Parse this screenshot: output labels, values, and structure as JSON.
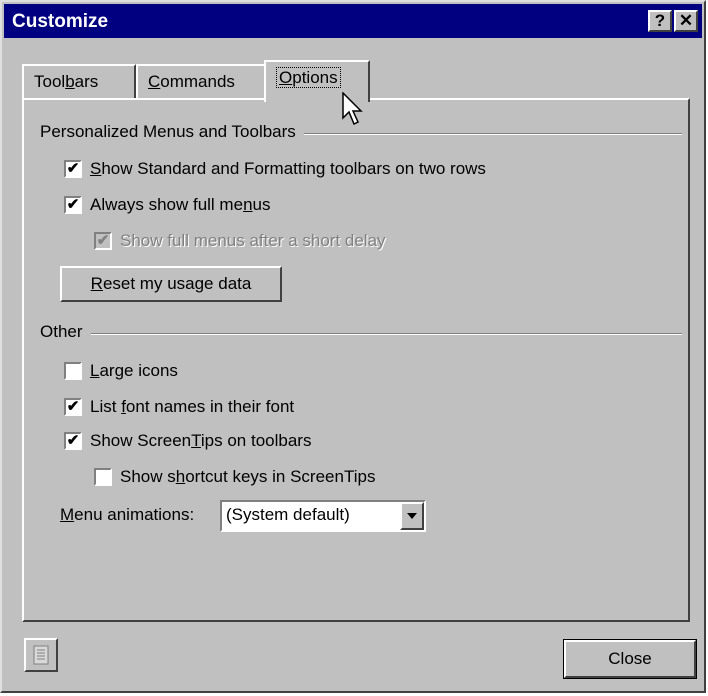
{
  "window": {
    "title": "Customize",
    "help_label": "?",
    "close_label": "✕"
  },
  "tabs": [
    {
      "pre": "Tool",
      "u": "b",
      "post": "ars"
    },
    {
      "pre": "",
      "u": "C",
      "post": "ommands"
    },
    {
      "pre": "",
      "u": "O",
      "post": "ptions"
    }
  ],
  "personalized": {
    "group_label": "Personalized Menus and Toolbars",
    "two_rows": {
      "pre": "",
      "u": "S",
      "post": "how Standard and Formatting toolbars on two rows",
      "checked": "✔"
    },
    "full_menus": {
      "pre": "Always show full me",
      "u": "n",
      "post": "us",
      "checked": "✔"
    },
    "short_delay": {
      "label": "Show full menus after a short delay",
      "checked": "✔"
    },
    "reset": {
      "pre": "",
      "u": "R",
      "post": "eset my usage data"
    }
  },
  "other": {
    "group_label": "Other",
    "large_icons": {
      "pre": "",
      "u": "L",
      "post": "arge icons",
      "checked": ""
    },
    "font_names": {
      "pre": "List ",
      "u": "f",
      "post": "ont names in their font",
      "checked": "✔"
    },
    "screentips": {
      "pre": "Show Screen",
      "u": "T",
      "post": "ips on toolbars",
      "checked": "✔"
    },
    "shortcut_keys": {
      "pre": "Show s",
      "u": "h",
      "post": "ortcut keys in ScreenTips",
      "checked": ""
    },
    "animations": {
      "pre": "",
      "u": "M",
      "post": "enu animations:",
      "value": "(System default)"
    }
  },
  "footer": {
    "close_label": "Close"
  }
}
